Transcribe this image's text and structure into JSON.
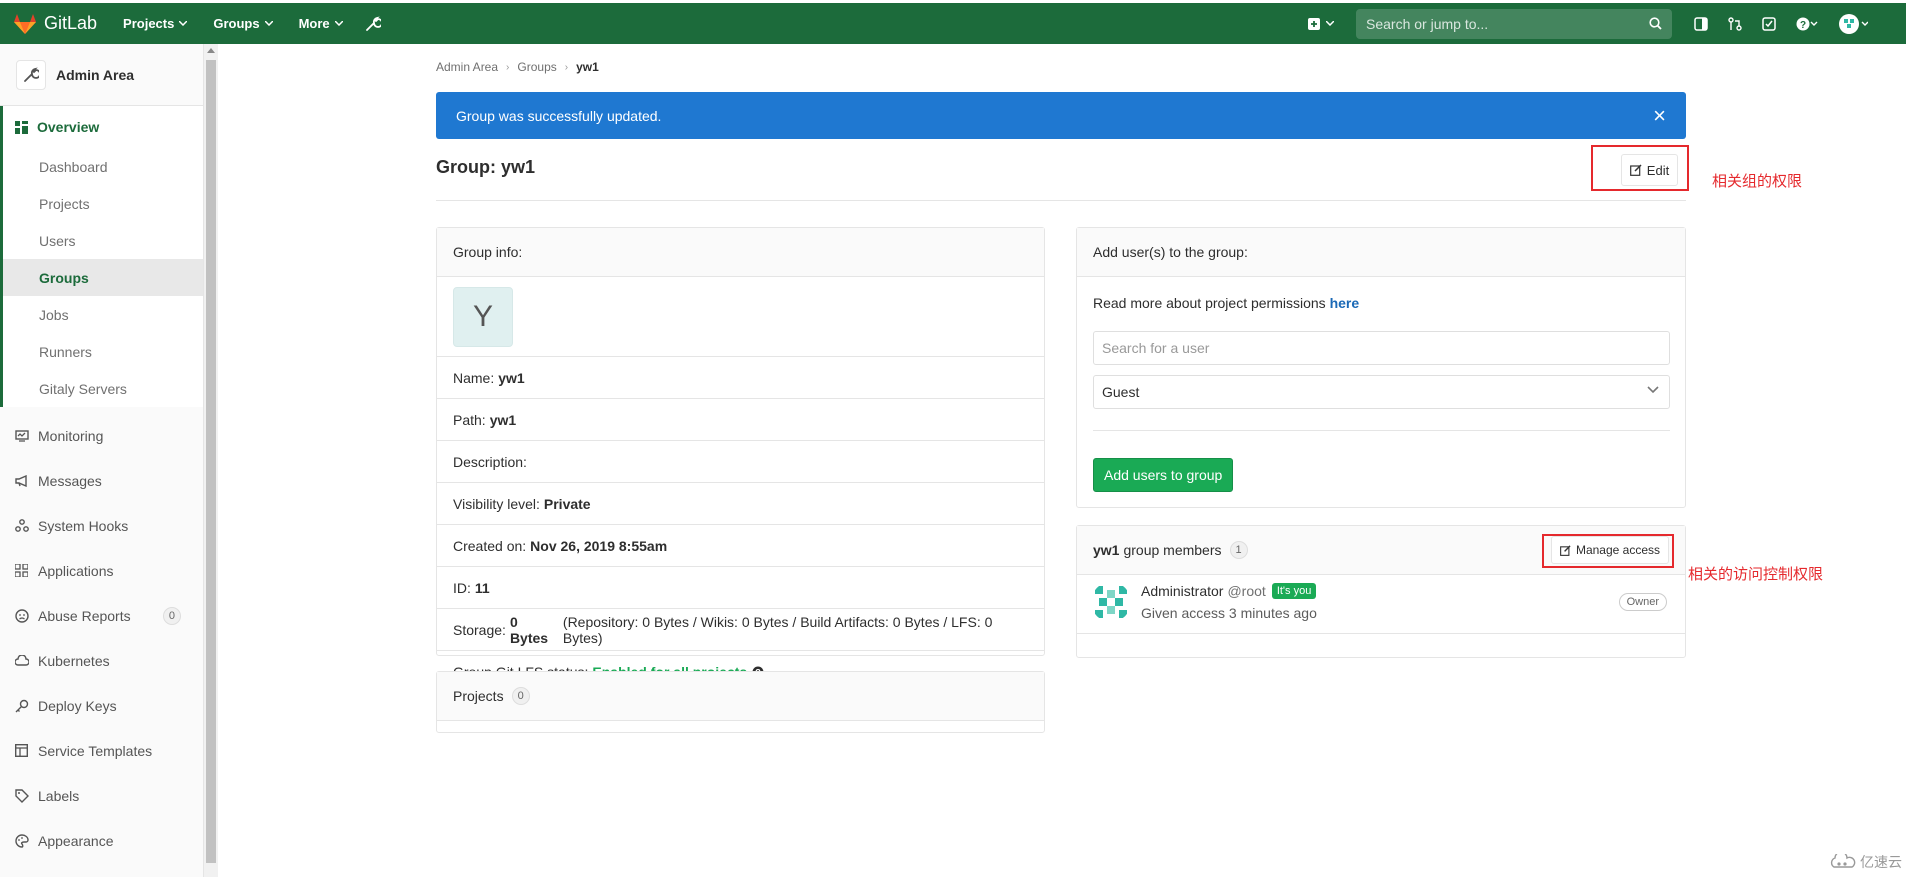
{
  "topbar": {
    "brand": "GitLab",
    "nav": [
      "Projects",
      "Groups",
      "More"
    ],
    "search_placeholder": "Search or jump to...",
    "colors": {
      "navbar": "#1c6b3b",
      "logo": "#e24329"
    }
  },
  "sidebar": {
    "title": "Admin Area",
    "overview": "Overview",
    "overview_items": [
      "Dashboard",
      "Projects",
      "Users",
      "Groups",
      "Jobs",
      "Runners",
      "Gitaly Servers"
    ],
    "active_item": "Groups",
    "items": [
      {
        "label": "Monitoring",
        "icon": "monitor-icon"
      },
      {
        "label": "Messages",
        "icon": "megaphone-icon"
      },
      {
        "label": "System Hooks",
        "icon": "hook-icon"
      },
      {
        "label": "Applications",
        "icon": "applications-icon"
      },
      {
        "label": "Abuse Reports",
        "icon": "abuse-icon",
        "badge": "0"
      },
      {
        "label": "Kubernetes",
        "icon": "cloud-icon"
      },
      {
        "label": "Deploy Keys",
        "icon": "key-icon"
      },
      {
        "label": "Service Templates",
        "icon": "template-icon"
      },
      {
        "label": "Labels",
        "icon": "label-icon"
      },
      {
        "label": "Appearance",
        "icon": "appearance-icon"
      }
    ]
  },
  "breadcrumb": [
    "Admin Area",
    "Groups",
    "yw1"
  ],
  "flash": {
    "message": "Group was successfully updated.",
    "close": "×",
    "color": "#1f78d1"
  },
  "page": {
    "title": "Group: yw1",
    "edit": "Edit"
  },
  "group_info": {
    "header": "Group info:",
    "avatar_letter": "Y",
    "name_label": "Name:",
    "name_value": "yw1",
    "path_label": "Path:",
    "path_value": "yw1",
    "description_label": "Description:",
    "visibility_label": "Visibility level:",
    "visibility_value": "Private",
    "created_label": "Created on:",
    "created_value": "Nov 26, 2019 8:55am",
    "id_label": "ID:",
    "id_value": "11",
    "storage_label": "Storage:",
    "storage_value": "0 Bytes",
    "storage_detail": "(Repository: 0 Bytes / Wikis: 0 Bytes / Build Artifacts: 0 Bytes / LFS: 0 Bytes)",
    "lfs_label": "Group Git LFS status:",
    "lfs_value": "Enabled for all projects"
  },
  "projects_panel": {
    "title": "Projects",
    "count": "0"
  },
  "add_users": {
    "header": "Add user(s) to the group:",
    "permissions_text": "Read more about project permissions",
    "permissions_link": "here",
    "search_placeholder": "Search for a user",
    "role": "Guest",
    "submit": "Add users to group"
  },
  "members": {
    "group": "yw1",
    "title_suffix": "group members",
    "count": "1",
    "manage": "Manage access",
    "list": [
      {
        "name": "Administrator",
        "handle": "@root",
        "badge": "It's you",
        "access": "Given access 3 minutes ago",
        "role": "Owner"
      }
    ]
  },
  "annotations": {
    "edit_note": "相关组的权限",
    "manage_note": "相关的访问控制权限",
    "color": "#e5292d"
  },
  "watermark": "亿速云"
}
